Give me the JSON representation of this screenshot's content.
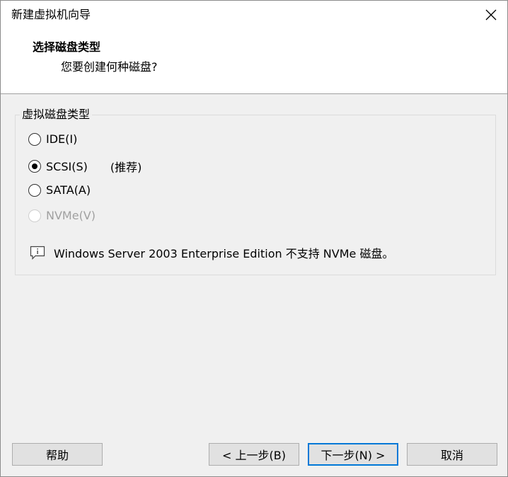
{
  "window": {
    "title": "新建虚拟机向导"
  },
  "header": {
    "title": "选择磁盘类型",
    "subtitle": "您要创建何种磁盘?"
  },
  "disk_group": {
    "legend": "虚拟磁盘类型",
    "options": [
      {
        "label": "IDE(I)",
        "checked": false,
        "disabled": false
      },
      {
        "label": "SCSI(S)",
        "checked": true,
        "disabled": false,
        "note": "(推荐)"
      },
      {
        "label": "SATA(A)",
        "checked": false,
        "disabled": false
      },
      {
        "label": "NVMe(V)",
        "checked": false,
        "disabled": true
      }
    ],
    "info_text": "Windows Server 2003 Enterprise Edition 不支持 NVMe 磁盘。"
  },
  "buttons": {
    "help": "帮助",
    "back": "< 上一步(B)",
    "next": "下一步(N) >",
    "cancel": "取消"
  },
  "colors": {
    "accent": "#0078d7",
    "background": "#f0f0f0",
    "disabled_text": "#a0a0a0"
  },
  "icons": {
    "close": "close-icon",
    "info": "info-icon"
  }
}
